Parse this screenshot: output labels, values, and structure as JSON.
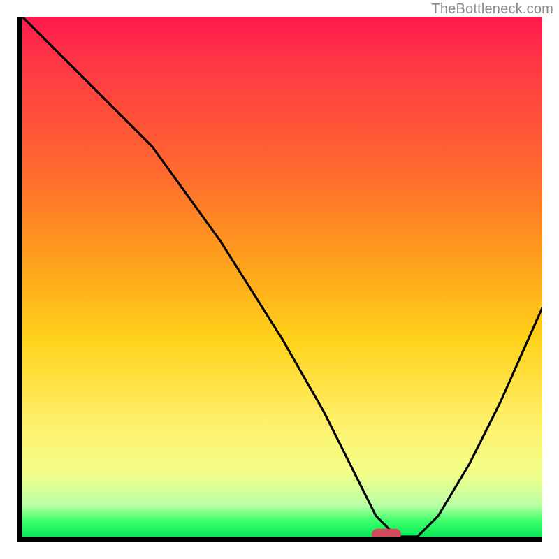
{
  "watermark": "TheBottleneck.com",
  "chart_data": {
    "type": "line",
    "title": "",
    "xlabel": "",
    "ylabel": "",
    "xlim": [
      0,
      100
    ],
    "ylim": [
      0,
      100
    ],
    "grid": false,
    "legend": false,
    "series": [
      {
        "name": "curve",
        "x": [
          0,
          12,
          25,
          38,
          50,
          58,
          64,
          68,
          72,
          76,
          80,
          86,
          92,
          100
        ],
        "y": [
          100,
          88,
          75,
          57,
          38,
          24,
          12,
          4,
          0,
          0,
          4,
          14,
          26,
          44
        ]
      }
    ],
    "marker": {
      "x_pct": 70,
      "y_pct": 0
    },
    "gradient_stops": [
      {
        "pct": 0,
        "color": "#ff1a4d"
      },
      {
        "pct": 10,
        "color": "#ff3a44"
      },
      {
        "pct": 30,
        "color": "#ff6a2e"
      },
      {
        "pct": 45,
        "color": "#ff9a1e"
      },
      {
        "pct": 62,
        "color": "#ffd21a"
      },
      {
        "pct": 78,
        "color": "#fff06a"
      },
      {
        "pct": 88,
        "color": "#f2ff8a"
      },
      {
        "pct": 94,
        "color": "#b9ffa6"
      },
      {
        "pct": 97,
        "color": "#3cff6a"
      },
      {
        "pct": 100,
        "color": "#08e85a"
      }
    ]
  }
}
